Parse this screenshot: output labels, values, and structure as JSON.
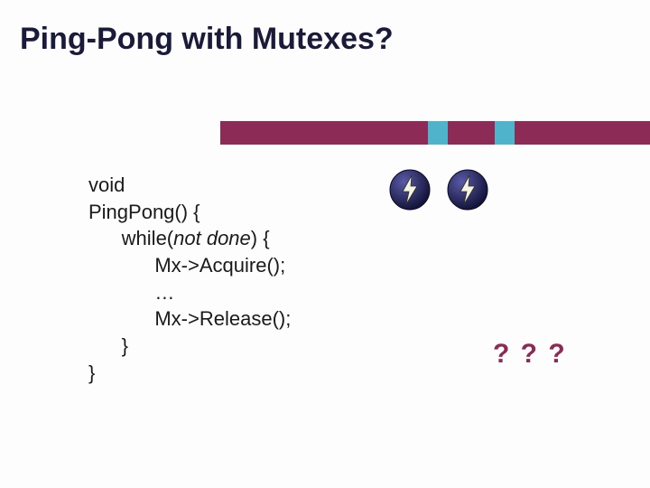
{
  "title": "Ping-Pong with Mutexes?",
  "code": {
    "l1": "void",
    "l2": "PingPong() {",
    "l3": "      while(",
    "l3b": "not done",
    "l3c": ") {",
    "l4": "            Mx->Acquire();",
    "l5": "            …",
    "l6": "            Mx->Release();",
    "l7": "      }",
    "l8": "}"
  },
  "question": "? ? ?",
  "icons": {
    "thread1": "lightning-thread-icon",
    "thread2": "lightning-thread-icon"
  },
  "colors": {
    "accent_dark": "#1a1a3a",
    "bar_maroon": "#8c2b56",
    "bar_cyan": "#4fb3c9",
    "thread_fill": "#20205a"
  }
}
